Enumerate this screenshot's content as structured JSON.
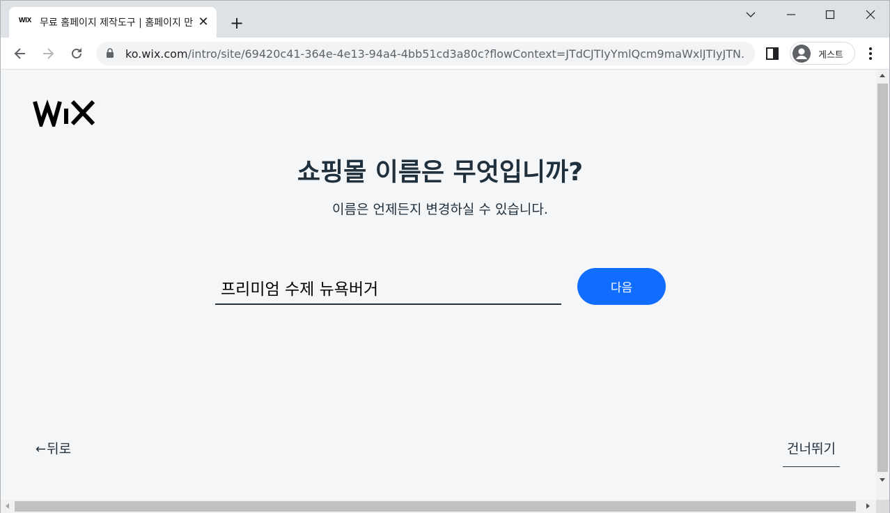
{
  "browser": {
    "tab": {
      "favicon_text": "WIX",
      "title": "무료 홈페이지 제작도구 | 홈페이지 만들기"
    },
    "url": {
      "host": "ko.wix.com",
      "path": "/intro/site/69420c41-364e-4e13-94a4-4bb51cd3a80c?flowContext=JTdCJTIyYmlQcm9maWxlJTIyJTN..."
    },
    "profile_label": "게스트"
  },
  "page": {
    "logo_text": "WIX",
    "heading": "쇼핑몰 이름은 무엇입니까?",
    "subheading": "이름은 언제든지 변경하실 수 있습니다.",
    "name_input_value": "프리미엄 수제 뉴욕버거",
    "next_label": "다음",
    "back_arrow": "←",
    "back_label": "뒤로",
    "skip_label": "건너뛰기"
  },
  "colors": {
    "accent": "#116dff",
    "text": "#20303c",
    "background": "#f5f6f8"
  }
}
